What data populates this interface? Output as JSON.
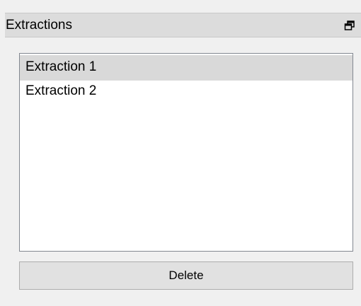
{
  "panel": {
    "title": "Extractions",
    "float_icon": "restore-window-icon"
  },
  "list": {
    "items": [
      {
        "label": "Extraction 1",
        "selected": true
      },
      {
        "label": "Extraction 2",
        "selected": false
      }
    ]
  },
  "actions": {
    "delete_label": "Delete"
  },
  "colors": {
    "background": "#f0f0f0",
    "titlebar": "#dcdcdc",
    "selection": "#d9d9d9",
    "list_border": "#828790",
    "button_face": "#e1e1e1"
  }
}
